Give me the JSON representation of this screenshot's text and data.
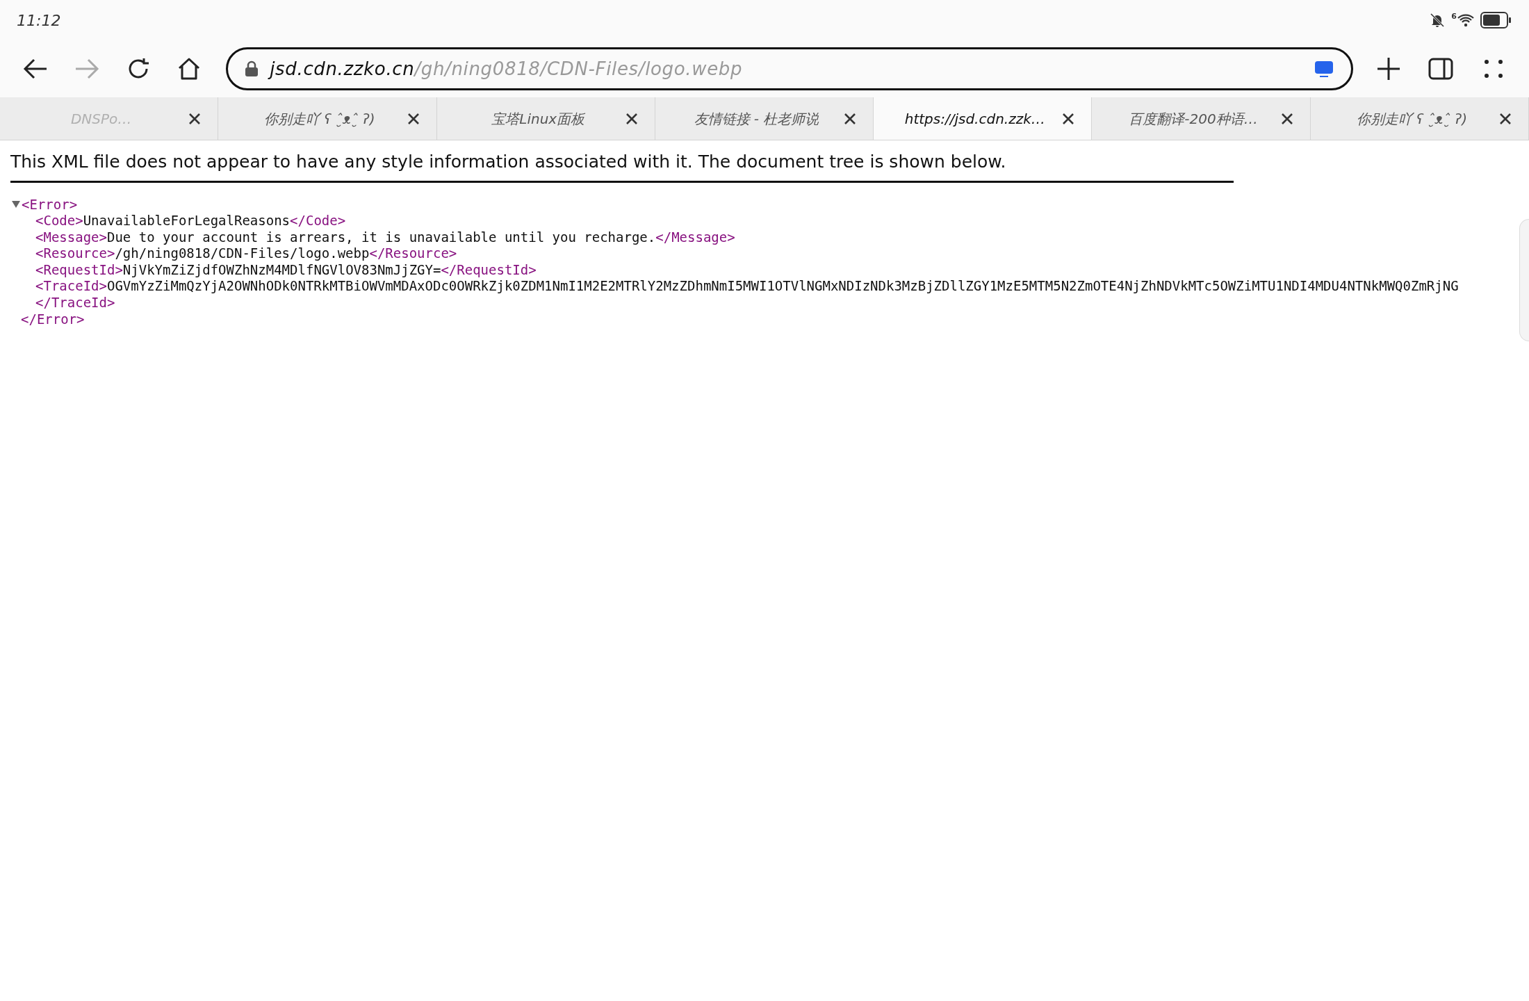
{
  "status_bar": {
    "time": "11:12",
    "wifi_label": "6"
  },
  "toolbar": {
    "forward_disabled": true,
    "url_host": "jsd.cdn.zzko.cn",
    "url_path": "/gh/ning0818/CDN-Files/logo.webp"
  },
  "tabs": [
    {
      "title": "DNSPo…",
      "selected": false,
      "faded": true
    },
    {
      "title": "你别走吖 ʕ ˆ̮ᴥˆ̮ ʔ)",
      "selected": false,
      "faded": false
    },
    {
      "title": "宝塔Linux面板",
      "selected": false,
      "faded": false
    },
    {
      "title": "友情链接 - 杜老师说",
      "selected": false,
      "faded": false
    },
    {
      "title": "https://jsd.cdn.zzk…",
      "selected": true,
      "faded": false
    },
    {
      "title": "百度翻译-200种语…",
      "selected": false,
      "faded": false
    },
    {
      "title": "你别走吖 ʕ ˆ̮ᴥˆ̮ ʔ)",
      "selected": false,
      "faded": false
    }
  ],
  "notice": "This XML file does not appear to have any style information associated with it. The document tree is shown below.",
  "xml": {
    "expanded": true,
    "open": "<Error>",
    "close": "</Error>",
    "lines": [
      [
        {
          "kind": "tag",
          "text": "<Code>"
        },
        {
          "kind": "text",
          "text": "UnavailableForLegalReasons"
        },
        {
          "kind": "tag",
          "text": "</Code>"
        }
      ],
      [
        {
          "kind": "tag",
          "text": "<Message>"
        },
        {
          "kind": "text",
          "text": "Due to your account is arrears, it is unavailable until you recharge."
        },
        {
          "kind": "tag",
          "text": "</Message>"
        }
      ],
      [
        {
          "kind": "tag",
          "text": "<Resource>"
        },
        {
          "kind": "text",
          "text": "/gh/ning0818/CDN-Files/logo.webp"
        },
        {
          "kind": "tag",
          "text": "</Resource>"
        }
      ],
      [
        {
          "kind": "tag",
          "text": "<RequestId>"
        },
        {
          "kind": "text",
          "text": "NjVkYmZiZjdfOWZhNzM4MDlfNGVlOV83NmJjZGY="
        },
        {
          "kind": "tag",
          "text": "</RequestId>"
        }
      ],
      [
        {
          "kind": "tag",
          "text": "<TraceId>"
        },
        {
          "kind": "text",
          "text": "OGVmYzZiMmQzYjA2OWNhODk0NTRkMTBiOWVmMDAxODc0OWRkZjk0ZDM1NmI1M2E2MTRlY2MzZDhmNmI5MWI1OTVlNGMxNDIzNDk3MzBjZDllZGY1MzE5MTM5N2ZmOTE4NjZhNDVkMTc5OWZiMTU1NDI4MDU4NTNkMWQ0ZmRjNG"
        }
      ],
      [
        {
          "kind": "tag",
          "text": "</TraceId>"
        }
      ]
    ]
  }
}
